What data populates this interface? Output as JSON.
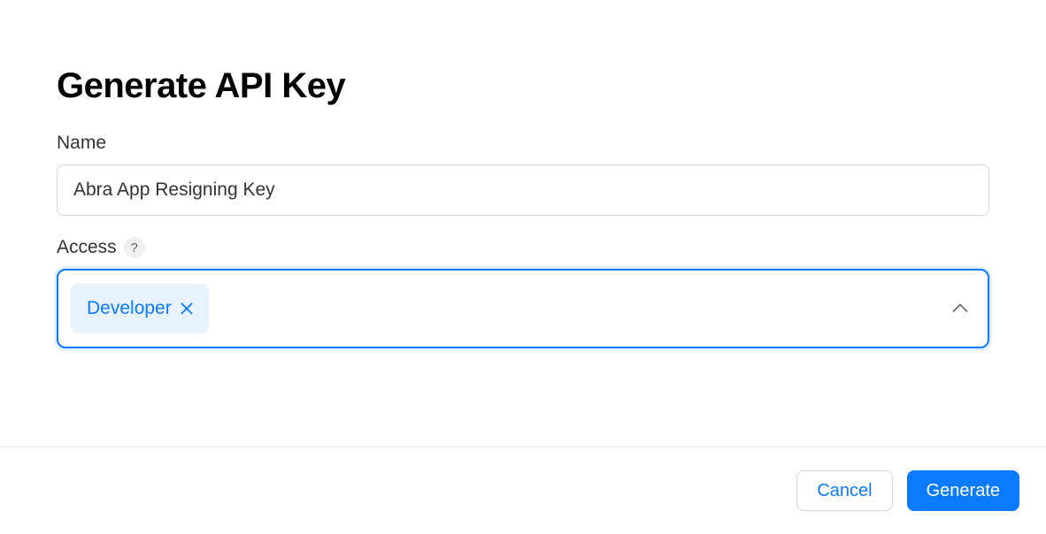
{
  "title": "Generate API Key",
  "fields": {
    "name": {
      "label": "Name",
      "value": "Abra App Resigning Key"
    },
    "access": {
      "label": "Access",
      "selected": [
        {
          "label": "Developer"
        }
      ]
    }
  },
  "buttons": {
    "cancel": "Cancel",
    "generate": "Generate"
  }
}
